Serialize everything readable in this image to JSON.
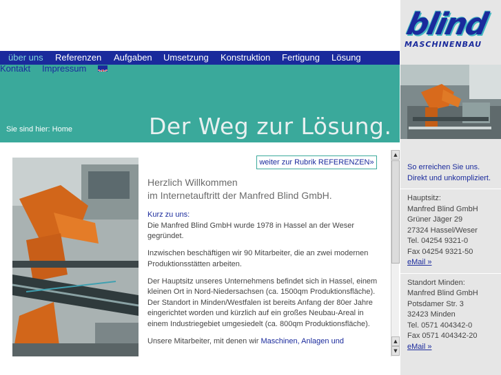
{
  "brand": {
    "name": "blind",
    "subtitle": "MASCHINENBAU",
    "primary_color": "#1a2a9c",
    "teal_color": "#3aa99b"
  },
  "nav": {
    "items": [
      {
        "label": "über uns",
        "active": true
      },
      {
        "label": "Referenzen"
      },
      {
        "label": "Aufgaben"
      },
      {
        "label": "Umsetzung"
      },
      {
        "label": "Konstruktion"
      },
      {
        "label": "Fertigung"
      },
      {
        "label": "Lösung"
      }
    ],
    "row2": [
      {
        "label": "Kontakt"
      },
      {
        "label": "Impressum"
      }
    ],
    "flag_icon": "uk-flag-icon"
  },
  "banner": {
    "breadcrumb": "Sie sind hier: Home",
    "slogan": "Der Weg zur Lösung."
  },
  "content": {
    "more_link": "weiter zur Rubrik REFERENZEN»",
    "welcome_line1": "Herzlich Willkommen",
    "welcome_line2": "im Internetauftritt der Manfred Blind GmbH.",
    "kurz_label": "Kurz zu uns:",
    "p1": "Die Manfred Blind GmbH wurde 1978 in Hassel an der Weser gegründet.",
    "p2": "Inzwischen beschäftigen wir 90 Mitarbeiter, die an zwei modernen Produktionsstätten arbeiten.",
    "p3": "Der Hauptsitz unseres Unternehmens befindet sich in Hassel, einem kleinen Ort in Nord-Niedersachsen (ca. 1500qm Produktionsfläche). Der Standort in Minden/Westfalen ist bereits Anfang der 80er Jahre eingerichtet worden und kürzlich auf ein großes Neubau-Areal in einem Industriegebiet umgesiedelt (ca. 800qm Produktionsfläche).",
    "p4_start": "Unsere Mitarbeiter, mit denen wir ",
    "p4_link": "Maschinen, Anlagen und"
  },
  "contact": {
    "intro1": "So erreichen Sie uns.",
    "intro2": "Direkt und unkompliziert.",
    "hq": {
      "label": "Hauptsitz:",
      "company": "Manfred Blind GmbH",
      "street": "Grüner Jäger 29",
      "city": "27324 Hassel/Weser",
      "tel": "Tel. 04254 9321-0",
      "fax": "Fax 04254 9321-50",
      "email": "eMail »"
    },
    "minden": {
      "label": "Standort Minden:",
      "company": "Manfred Blind GmbH",
      "street": "Potsdamer Str. 3",
      "city": "32423 Minden",
      "tel": "Tel. 0571 404342-0",
      "fax": "Fax 0571 404342-20",
      "email": "eMail »"
    }
  },
  "scrollbar": {
    "up_icon": "arrow-up-icon",
    "down_icon": "arrow-down-icon"
  }
}
